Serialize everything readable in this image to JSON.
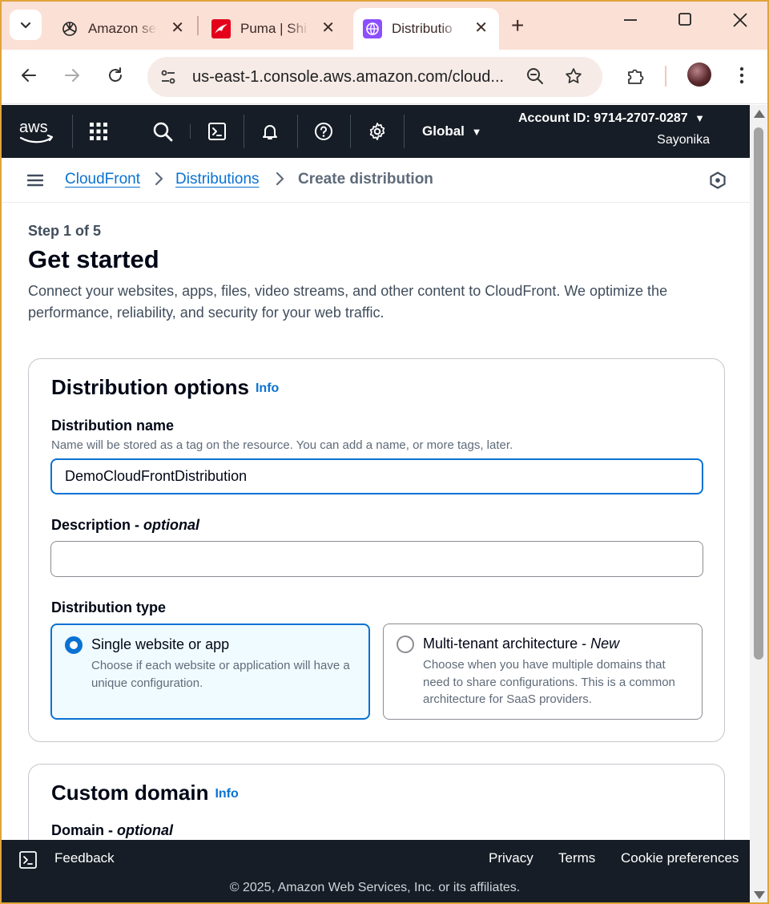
{
  "browser": {
    "tabs": [
      {
        "title": "Amazon se",
        "icon": "openai-icon"
      },
      {
        "title": "Puma | Shi",
        "icon": "puma-icon"
      },
      {
        "title": "Distributio",
        "icon": "cloudfront-icon",
        "active": true
      }
    ],
    "url": "us-east-1.console.aws.amazon.com/cloud..."
  },
  "aws_nav": {
    "region": "Global",
    "account": "Account ID: 9714-2707-0287",
    "user": "Sayonika"
  },
  "breadcrumb": {
    "items": [
      "CloudFront",
      "Distributions"
    ],
    "current": "Create distribution"
  },
  "page": {
    "step": "Step 1 of 5",
    "title": "Get started",
    "intro": "Connect your websites, apps, files, video streams, and other content to CloudFront. We optimize the performance, reliability, and security for your web traffic."
  },
  "distribution_options": {
    "title": "Distribution options",
    "info": "Info",
    "name_label": "Distribution name",
    "name_hint": "Name will be stored as a tag on the resource. You can add a name, or more tags, later.",
    "name_value": "DemoCloudFrontDistribution",
    "description_label": "Description - ",
    "description_optional": "optional",
    "description_value": "",
    "type_label": "Distribution type",
    "options": [
      {
        "title": "Single website or app",
        "desc": "Choose if each website or application will have a unique configuration.",
        "selected": true
      },
      {
        "title": "Multi-tenant architecture - ",
        "title_em": "New",
        "desc": "Choose when you have multiple domains that need to share configurations. This is a common architecture for SaaS providers.",
        "selected": false
      }
    ]
  },
  "custom_domain": {
    "title": "Custom domain",
    "info": "Info",
    "domain_label": "Domain - ",
    "domain_optional": "optional"
  },
  "footer": {
    "feedback": "Feedback",
    "links": [
      "Privacy",
      "Terms",
      "Cookie preferences"
    ],
    "copyright": "© 2025, Amazon Web Services, Inc. or its affiliates."
  },
  "colors": {
    "link": "#0972d3",
    "nav_bg": "#161d26",
    "tabstrip_bg": "#fbe0d6"
  }
}
